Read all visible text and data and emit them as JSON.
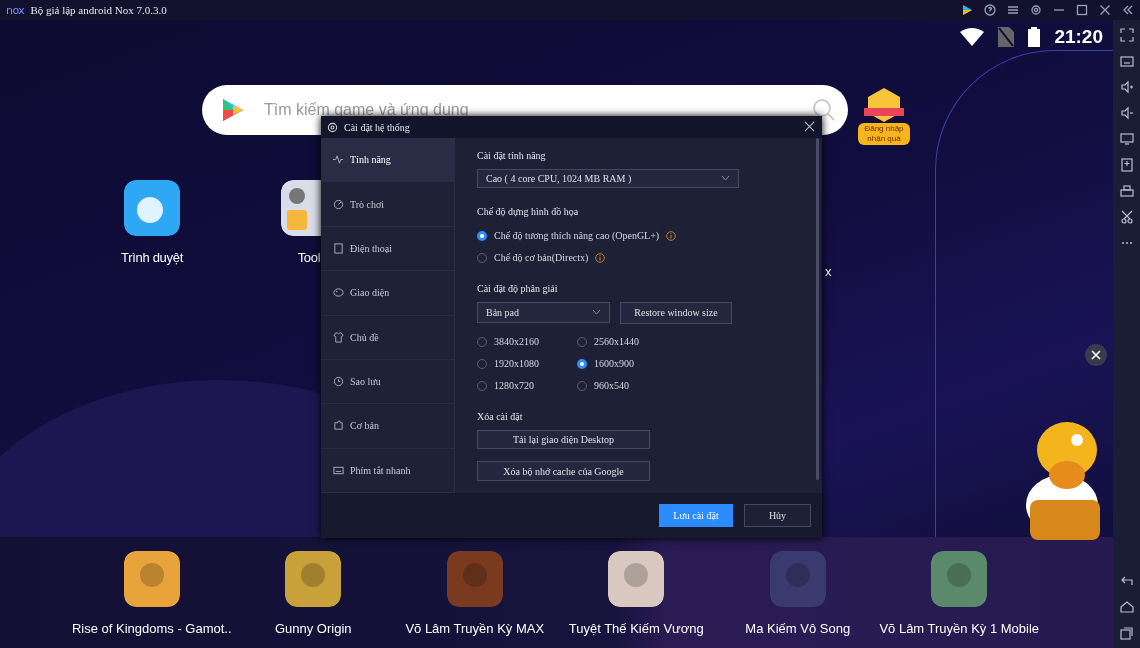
{
  "window": {
    "logo": "nox",
    "title": "Bộ giả lập android Nox 7.0.3.0"
  },
  "status_bar": {
    "time": "21:20"
  },
  "search": {
    "placeholder": "Tìm kiếm game và ứng dụng"
  },
  "gift_badge": {
    "label": "Đăng nhập nhận quà"
  },
  "desktop_apps": [
    {
      "label": "Trình duyệt"
    },
    {
      "label": "Tool"
    },
    {
      "label": "x"
    }
  ],
  "dialog": {
    "title": "Cài đặt hệ thống",
    "nav": [
      {
        "label": "Tính năng",
        "selected": true
      },
      {
        "label": "Trò chơi",
        "selected": false
      },
      {
        "label": "Điện thoại",
        "selected": false
      },
      {
        "label": "Giao diện",
        "selected": false
      },
      {
        "label": "Chủ đề",
        "selected": false
      },
      {
        "label": "Sao lưu",
        "selected": false
      },
      {
        "label": "Cơ bản",
        "selected": false
      },
      {
        "label": "Phím tắt nhanh",
        "selected": false
      }
    ],
    "performance": {
      "heading": "Cài đặt tính năng",
      "value": "Cao ( 4 core CPU, 1024 MB RAM )"
    },
    "render": {
      "heading": "Chế độ dựng hình đồ họa",
      "options": [
        {
          "label": "Chế độ tương thích nâng cao (OpenGL+)",
          "selected": true
        },
        {
          "label": "Chế độ cơ bản(Directx)",
          "selected": false
        }
      ]
    },
    "resolution": {
      "heading": "Cài đặt độ phân giải",
      "preset": "Bản pad",
      "restore_button": "Restore window size",
      "options": [
        {
          "label": "3840x2160",
          "selected": false
        },
        {
          "label": "2560x1440",
          "selected": false
        },
        {
          "label": "1920x1080",
          "selected": false
        },
        {
          "label": "1600x900",
          "selected": true
        },
        {
          "label": "1280x720",
          "selected": false
        },
        {
          "label": "960x540",
          "selected": false
        }
      ]
    },
    "reset": {
      "heading": "Xóa cài đặt",
      "buttons": [
        "Tải lại giao diện Desktop",
        "Xóa bộ nhớ cache của Google"
      ]
    },
    "footer_buttons": [
      {
        "label": "Lưu cài đặt",
        "kind": "primary"
      },
      {
        "label": "Hủy",
        "kind": "secondary"
      }
    ]
  },
  "dock": [
    {
      "label": "Rise of Kingdoms - Gamot.."
    },
    {
      "label": "Gunny Origin"
    },
    {
      "label": "Võ Lâm Truyền Kỳ MAX"
    },
    {
      "label": "Tuyệt Thế Kiếm Vương"
    },
    {
      "label": "Ma Kiếm Vô Song"
    },
    {
      "label": "Võ Lâm Truyền Kỳ 1 Mobile"
    }
  ]
}
